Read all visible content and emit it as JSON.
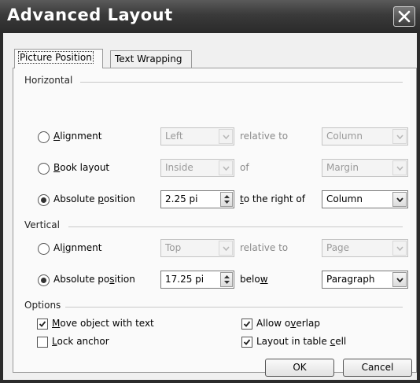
{
  "window": {
    "title": "Advanced Layout"
  },
  "tabs": [
    {
      "label": "Picture Position",
      "active": true
    },
    {
      "label": "Text Wrapping",
      "active": false
    }
  ],
  "horizontal": {
    "header": "Horizontal",
    "alignment": {
      "pre": "",
      "key": "A",
      "post": "lignment",
      "selected": false,
      "value": "Left",
      "rel_label": "relative to",
      "rel_value": "Column"
    },
    "book": {
      "pre": "",
      "key": "B",
      "post": "ook layout",
      "selected": false,
      "value": "Inside",
      "rel_label": "of",
      "rel_value": "Margin"
    },
    "absolute": {
      "pre": "Absolute ",
      "key": "p",
      "post": "osition",
      "selected": true,
      "value": "2.25 pi",
      "rel_pre": "",
      "rel_key": "t",
      "rel_post": "o the right of",
      "rel_value": "Column"
    }
  },
  "vertical": {
    "header": "Vertical",
    "alignment": {
      "pre": "Al",
      "key": "i",
      "post": "gnment",
      "selected": false,
      "value": "Top",
      "rel_label": "relative to",
      "rel_value": "Page"
    },
    "absolute": {
      "pre": "Absolute po",
      "key": "s",
      "post": "ition",
      "selected": true,
      "value": "17.25 pi",
      "rel_pre": "belo",
      "rel_key": "w",
      "rel_post": "",
      "rel_value": "Paragraph"
    }
  },
  "options": {
    "header": "Options",
    "move": {
      "pre": "",
      "key": "M",
      "post": "ove object with text",
      "checked": true
    },
    "lock": {
      "pre": "",
      "key": "L",
      "post": "ock anchor",
      "checked": false
    },
    "overlap": {
      "pre": "Allow o",
      "key": "v",
      "post": "erlap",
      "checked": true
    },
    "tablecell": {
      "pre": "Layout in table ",
      "key": "c",
      "post": "ell",
      "checked": true
    }
  },
  "buttons": {
    "ok": "OK",
    "cancel": "Cancel"
  },
  "icons": {
    "close": "close-icon",
    "dropdown": "chevron-down-icon",
    "spinner": "spinner-arrows-icon",
    "check": "checkmark-icon"
  },
  "colors": {
    "titlebar": "#3a3a3a",
    "client": "#f0f0f0",
    "panel": "#fafafa",
    "disabled_text": "#8a8a8a"
  }
}
